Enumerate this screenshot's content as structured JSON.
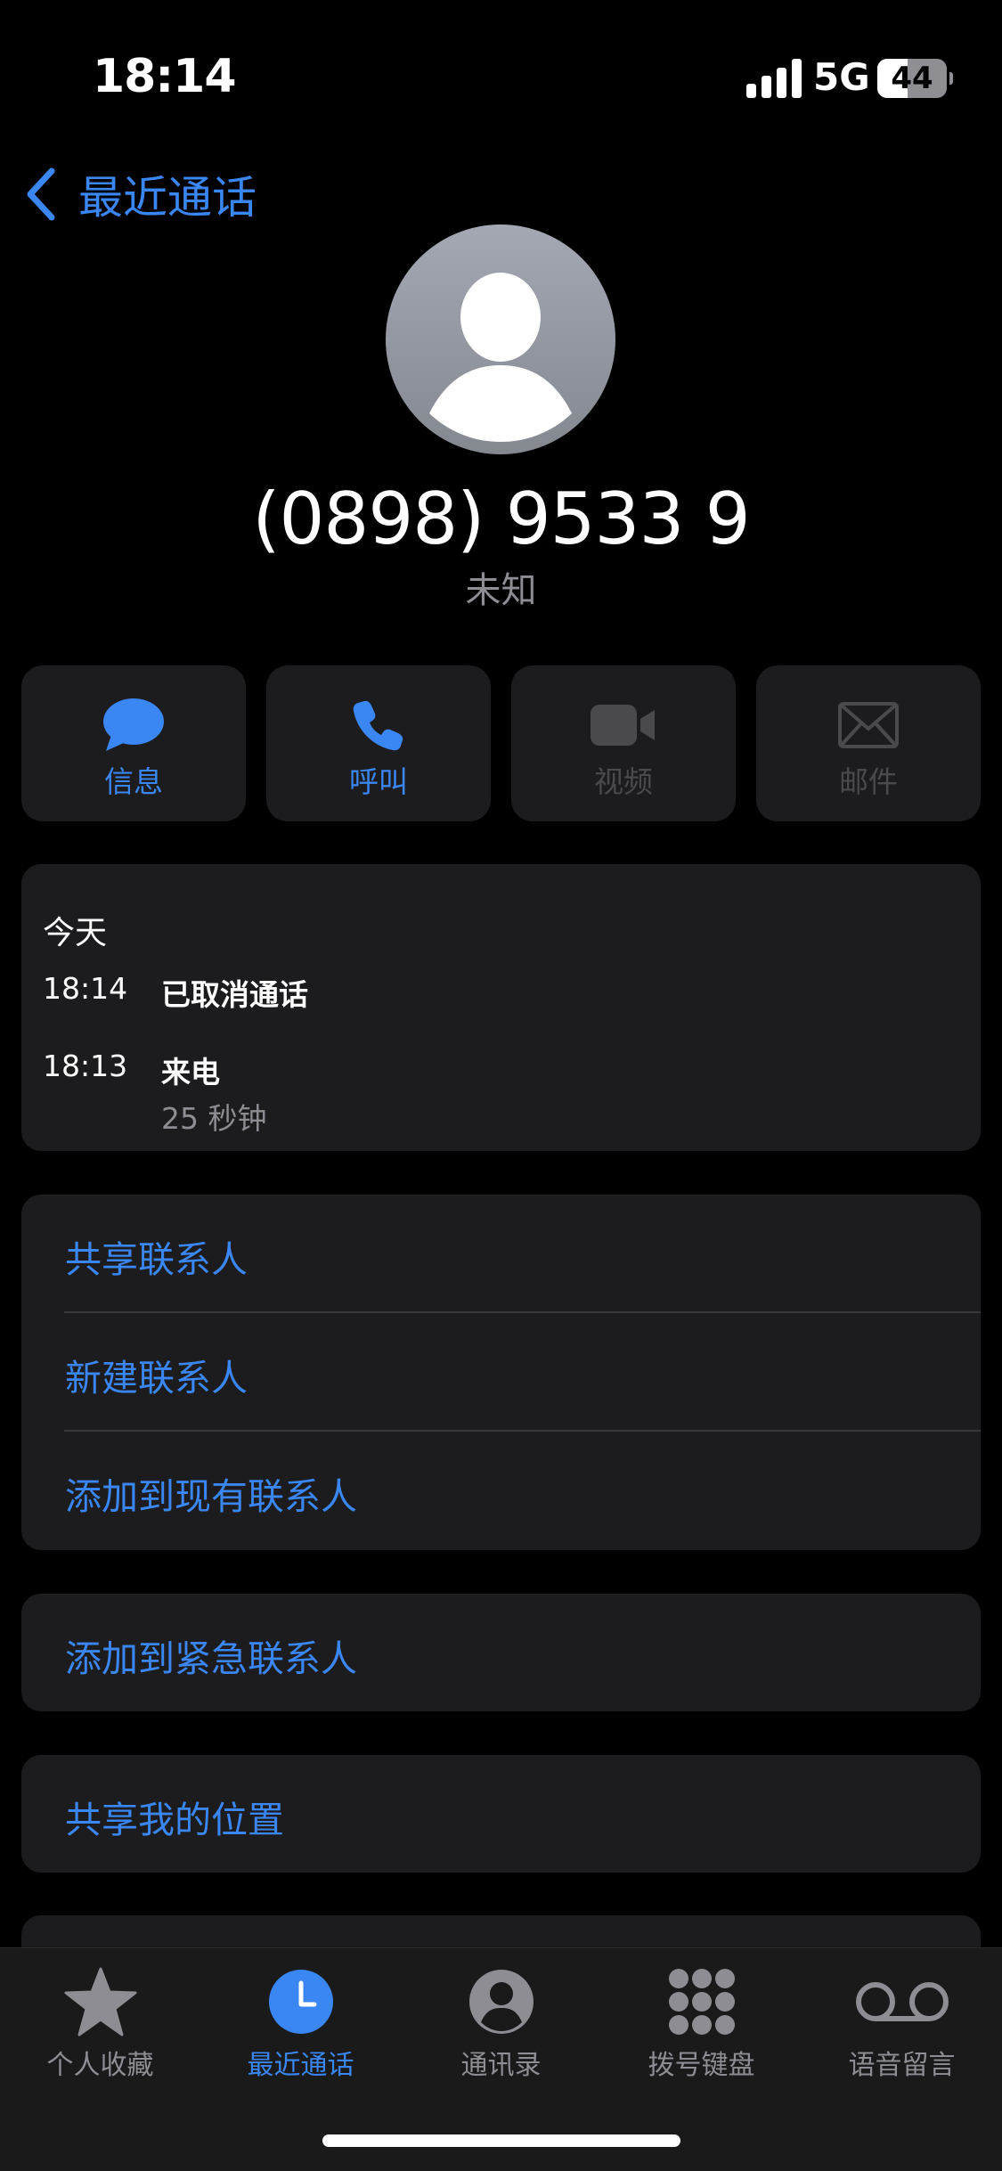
{
  "status_bar": {
    "time": "18:14",
    "network": "5G",
    "battery_level": "44",
    "battery_fraction": 0.44
  },
  "nav": {
    "back_label": "最近通话",
    "back_icon": "chevron-left-icon"
  },
  "contact": {
    "avatar_icon": "person-silhouette-icon",
    "phone_number": "(0898) 9533 9",
    "label": "未知"
  },
  "actions": [
    {
      "label": "信息",
      "icon": "message-bubble-icon",
      "enabled": true
    },
    {
      "label": "呼叫",
      "icon": "phone-icon",
      "enabled": true
    },
    {
      "label": "视频",
      "icon": "video-camera-icon",
      "enabled": false
    },
    {
      "label": "邮件",
      "icon": "envelope-icon",
      "enabled": false
    }
  ],
  "history": {
    "day": "今天",
    "calls": [
      {
        "time": "18:14",
        "type": "已取消通话",
        "duration": ""
      },
      {
        "time": "18:13",
        "type": "来电",
        "duration": "25 秒钟"
      }
    ]
  },
  "contact_actions": {
    "share_contact": "共享联系人",
    "new_contact": "新建联系人",
    "add_existing": "添加到现有联系人",
    "add_emergency": "添加到紧急联系人",
    "share_location": "共享我的位置"
  },
  "tab_bar": {
    "tabs": [
      {
        "label": "个人收藏",
        "icon": "star-icon",
        "active": false
      },
      {
        "label": "最近通话",
        "icon": "clock-icon",
        "active": true
      },
      {
        "label": "通讯录",
        "icon": "person-circle-icon",
        "active": false
      },
      {
        "label": "拨号键盘",
        "icon": "keypad-icon",
        "active": false
      },
      {
        "label": "语音留言",
        "icon": "voicemail-icon",
        "active": false
      }
    ]
  },
  "colors": {
    "accent": "#3a86f2",
    "background": "#000000",
    "card": "#1c1c1e",
    "secondary_text": "#8d8d93",
    "disabled": "#4a4a4e"
  }
}
